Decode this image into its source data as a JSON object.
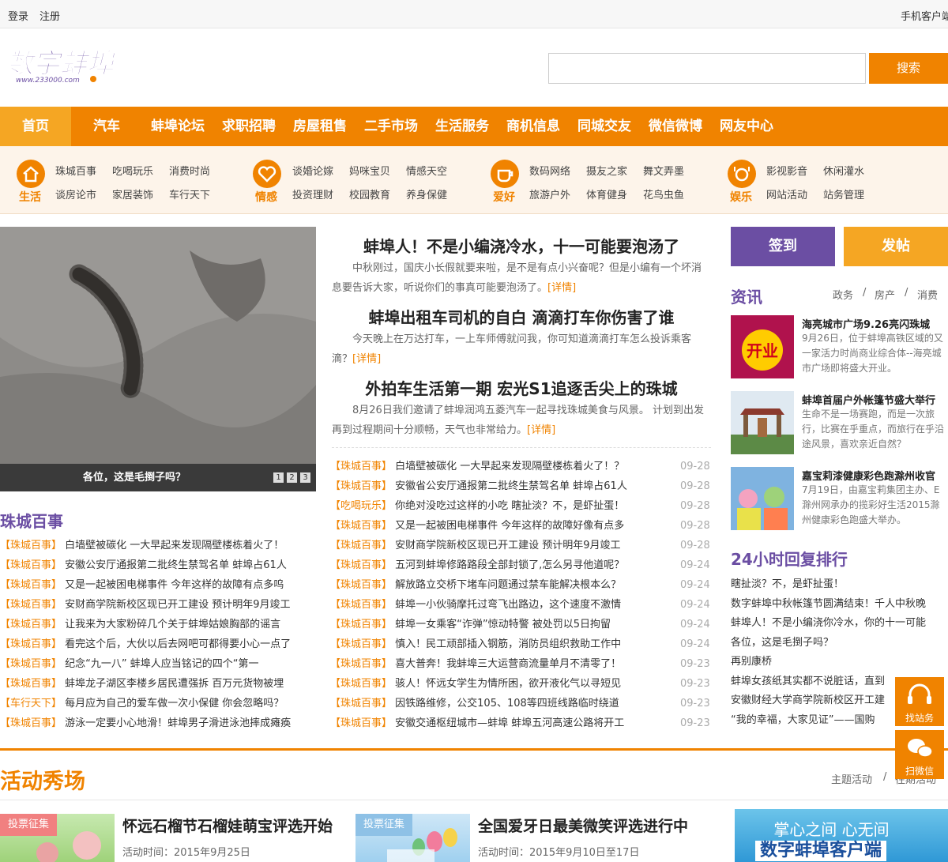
{
  "topbar": {
    "login": "登录",
    "register": "注册",
    "mobile": "手机客户端"
  },
  "logo": {
    "text": "数字蚌埠",
    "url_text": "www.233000.com"
  },
  "search": {
    "placeholder": "",
    "button": "搜索"
  },
  "nav": {
    "items": [
      "首页",
      "汽车",
      "蚌埠论坛",
      "求职招聘",
      "房屋租售",
      "二手市场",
      "生活服务",
      "商机信息",
      "同城交友",
      "微信微博",
      "网友中心"
    ]
  },
  "subnav": {
    "cats": [
      {
        "label": "生活",
        "icon": "house-icon",
        "links": [
          "珠城百事",
          "吃喝玩乐",
          "消费时尚",
          "谈房论市",
          "家居装饰",
          "车行天下"
        ]
      },
      {
        "label": "情感",
        "icon": "heart-icon",
        "links": [
          "谈婚论嫁",
          "妈咪宝贝",
          "情感天空",
          "投资理财",
          "校园教育",
          "养身保健"
        ]
      },
      {
        "label": "爱好",
        "icon": "cup-icon",
        "links": [
          "数码网络",
          "摄友之家",
          "舞文弄墨",
          "旅游户外",
          "体育健身",
          "花鸟虫鱼"
        ]
      },
      {
        "label": "娱乐",
        "icon": "plate-icon",
        "links": [
          "影视影音",
          "休闲灌水",
          "网站活动",
          "站务管理"
        ]
      }
    ]
  },
  "slideshow": {
    "caption": "各位，这是毛捯子吗？",
    "pages": [
      "1",
      "2",
      "3"
    ]
  },
  "headlines": [
    {
      "title": "蚌埠人！不是小编浇冷水，十一可能要泡汤了",
      "summary": "中秋刚过，国庆小长假就要来啦，是不是有点小兴奋呢？但是小编有一个坏消息要告诉大家，听说你们的事真可能要泡汤了。",
      "more": "[详情]"
    },
    {
      "title": "蚌埠出租车司机的自白 滴滴打车你伤害了谁",
      "summary": "今天晚上在万达打车，一上车师傅就问我，你可知道滴滴打车怎么投诉乘客滴？",
      "more": "[详情]"
    },
    {
      "title": "外拍车生活第一期 宏光S1追逐舌尖上的珠城",
      "summary": "8月26日我们邀请了蚌埠润鸿五菱汽车一起寻找珠城美食与风景。 计划到出发再到过程期间十分顺畅，天气也非常给力。",
      "more": "[详情]"
    }
  ],
  "zhucheng": {
    "title": "珠城百事",
    "rows": [
      {
        "tag": "【珠城百事】",
        "text": "白墙壁被碳化 一大早起来发现隔壁楼栋着火了！"
      },
      {
        "tag": "【珠城百事】",
        "text": "安徽公安厅通报第二批终生禁驾名单 蚌埠占61人"
      },
      {
        "tag": "【珠城百事】",
        "text": "又是一起被困电梯事件 今年这样的故障有点多呜"
      },
      {
        "tag": "【珠城百事】",
        "text": "安财商学院新校区现已开工建设 预计明年9月竣工"
      },
      {
        "tag": "【珠城百事】",
        "text": "让我来为大家粉碎几个关于蚌埠姑娘胸部的谣言"
      },
      {
        "tag": "【珠城百事】",
        "text": "看完这个后，大伙以后去网吧可都得要小心一点了"
      },
      {
        "tag": "【珠城百事】",
        "text": "纪念“九一八” 蚌埠人应当铭记的四个“第一"
      },
      {
        "tag": "【珠城百事】",
        "text": "蚌埠龙子湖区李楼乡居民遭强拆 百万元货物被埋"
      },
      {
        "tag": "【车行天下】",
        "text": "每月应为自己的爱车做一次小保健 你会忽略吗？"
      },
      {
        "tag": "【珠城百事】",
        "text": "游泳一定要小心地滑！蚌埠男子滑进泳池摔成瘫痪"
      }
    ]
  },
  "mid_list": [
    {
      "tag": "【珠城百事】",
      "text": "白墙壁被碳化 一大早起来发现隔壁楼栋着火了！？",
      "date": "09-28"
    },
    {
      "tag": "【珠城百事】",
      "text": "安徽省公安厅通报第二批终生禁驾名单 蚌埠占61人",
      "date": "09-28"
    },
    {
      "tag": "【吃喝玩乐】",
      "text": "你绝对没吃过这样的小吃 瞎扯淡？不，是虾扯蛋！",
      "date": "09-28"
    },
    {
      "tag": "【珠城百事】",
      "text": "又是一起被困电梯事件 今年这样的故障好像有点多",
      "date": "09-28"
    },
    {
      "tag": "【珠城百事】",
      "text": "安财商学院新校区现已开工建设 预计明年9月竣工",
      "date": "09-28"
    },
    {
      "tag": "【珠城百事】",
      "text": "五河到蚌埠修路路段全部封锁了,怎么另寻他道呢？",
      "date": "09-24"
    },
    {
      "tag": "【珠城百事】",
      "text": "解放路立交桥下堵车问题通过禁车能解决根本么？",
      "date": "09-24"
    },
    {
      "tag": "【珠城百事】",
      "text": "蚌埠一小伙骑摩托过弯飞出路边，这个速度不激情",
      "date": "09-24"
    },
    {
      "tag": "【珠城百事】",
      "text": "蚌埠一女乘客“诈弹”惊动特警 被处罚以5日拘留",
      "date": "09-24"
    },
    {
      "tag": "【珠城百事】",
      "text": "慎入！民工顽部插入钢筋，消防员组织救助工作中",
      "date": "09-24"
    },
    {
      "tag": "【珠城百事】",
      "text": "喜大普奔！我蚌埠三大运营商流量单月不清零了！",
      "date": "09-23"
    },
    {
      "tag": "【珠城百事】",
      "text": "骇人！怀远女学生为情所困，欲开液化气以寻短见",
      "date": "09-23"
    },
    {
      "tag": "【珠城百事】",
      "text": "因铁路维修，公交105、108等四班线路临时绕道",
      "date": "09-23"
    },
    {
      "tag": "【珠城百事】",
      "text": "安徽交通枢纽城市—蚌埠 蚌埠五河高速公路将开工",
      "date": "09-23"
    }
  ],
  "side": {
    "checkin": "签到",
    "post": "发帖",
    "news_title": "资讯",
    "news_tabs": [
      "政务",
      "/",
      "房产",
      "/",
      "消费"
    ],
    "news": [
      {
        "title": "海亮城市广场9.26亮闪珠城",
        "desc": "9月26日，位于蚌埠高铁区域的又一家活力时尚商业综合体--海亮城市广场即将盛大开业。",
        "thumb": "thumb-kaiye"
      },
      {
        "title": "蚌埠首届户外帐篷节盛大举行",
        "desc": "生命不是一场赛跑，而是一次旅行，比赛在乎重点，而旅行在乎沿途风景，喜欢亲近自然？",
        "thumb": "thumb-tent"
      },
      {
        "title": "嘉宝莉漆健康彩色跑滁州收官",
        "desc": "7月19日，由嘉宝莉集团主办、E滁州网承办的揽彩好生活2015滁州健康彩色跑盛大举办。",
        "thumb": "thumb-colorrun"
      }
    ],
    "rank_title": "24小时回复排行",
    "rank": [
      "瞎扯淡？不，是虾扯蛋！",
      "数字蚌埠中秋帐篷节圆满结束！千人中秋晚",
      "蚌埠人！不是小编浇你冷水，你的十一可能",
      "各位，这是毛捯子吗？",
      "再别康桥",
      "蚌埠女孩纸其实都不说脏话，直到",
      "安徽财经大学商学院新校区开工建",
      "“我的幸福，大家见证”——国购"
    ]
  },
  "activity": {
    "title": "活动秀场",
    "tabs": [
      "主题活动",
      "/",
      "往期活动"
    ],
    "items": [
      {
        "tag": "投票征集",
        "name": "怀远石榴节石榴娃萌宝评选开始",
        "time": "活动时间：2015年9月25日"
      },
      {
        "tag": "投票征集",
        "name": "全国爱牙日最美微笑评选进行中",
        "time": "活动时间：2015年9月10日至17日"
      }
    ],
    "banner": {
      "line1": "掌心之间 心无间",
      "line2": "数字蚌埠客户端"
    }
  },
  "float": {
    "find": "找站务",
    "wechat": "扫微信"
  }
}
